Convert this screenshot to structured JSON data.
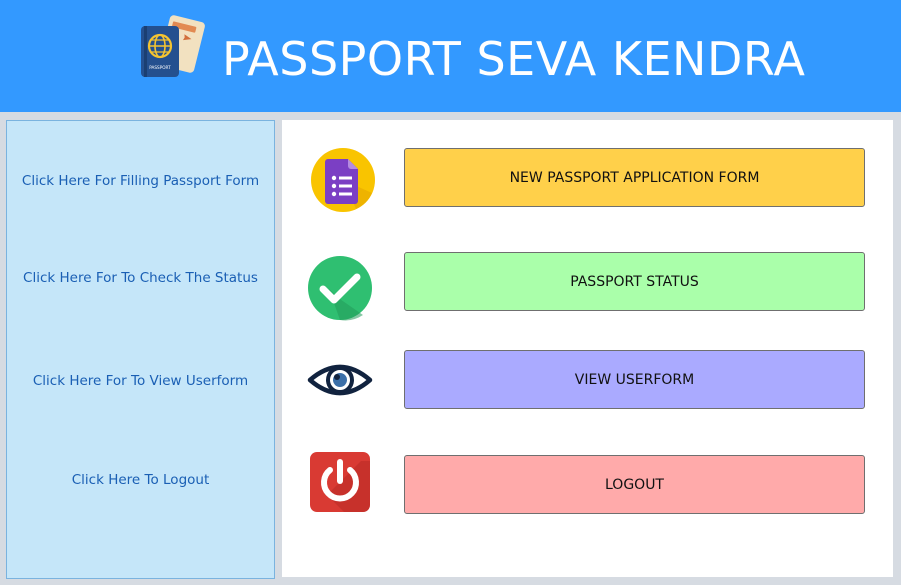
{
  "header": {
    "title": "PASSPORT SEVA KENDRA",
    "logo_icon": "passport-icon",
    "logo_text": "PASSPORT",
    "background": "#3399ff"
  },
  "sidebar": {
    "background": "#c5e6f9",
    "links": [
      {
        "label": "Click Here For Filling Passport Form"
      },
      {
        "label": "Click Here For To Check The Status"
      },
      {
        "label": "Click Here For To View Userform"
      },
      {
        "label": "Click Here To Logout"
      }
    ]
  },
  "actions": [
    {
      "label": "NEW PASSPORT APPLICATION FORM",
      "icon": "form-icon",
      "color": "#ffd04a"
    },
    {
      "label": "PASSPORT STATUS",
      "icon": "checkmark-icon",
      "color": "#aaffaa"
    },
    {
      "label": "VIEW USERFORM",
      "icon": "eye-icon",
      "color": "#aaaaff"
    },
    {
      "label": "LOGOUT",
      "icon": "power-icon",
      "color": "#ffaaaa"
    }
  ]
}
